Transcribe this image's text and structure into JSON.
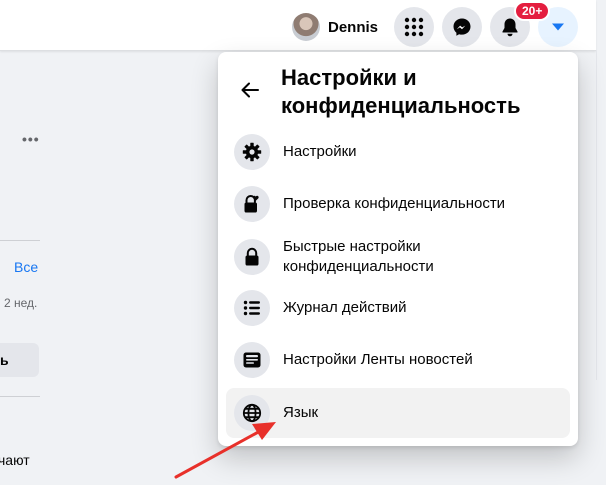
{
  "header": {
    "profile_name": "Dennis",
    "notifications_badge": "20+"
  },
  "feed_fragments": {
    "see_all": "Все",
    "time_ago": "2 нед.",
    "button_tail": "ь",
    "text_tail": "чают"
  },
  "settings_menu": {
    "title": "Настройки и конфиденциальность",
    "items": [
      {
        "label": "Настройки",
        "icon": "gear-icon"
      },
      {
        "label": "Проверка конфиденциальности",
        "icon": "lock-heart-icon"
      },
      {
        "label": "Быстрые настройки конфиденциальности",
        "icon": "lock-icon"
      },
      {
        "label": "Журнал действий",
        "icon": "list-icon"
      },
      {
        "label": "Настройки Ленты новостей",
        "icon": "news-feed-icon"
      },
      {
        "label": "Язык",
        "icon": "globe-icon"
      }
    ]
  },
  "colors": {
    "accent": "#1877f2",
    "badge": "#e41e3f",
    "annotation_arrow": "#e8302a"
  }
}
